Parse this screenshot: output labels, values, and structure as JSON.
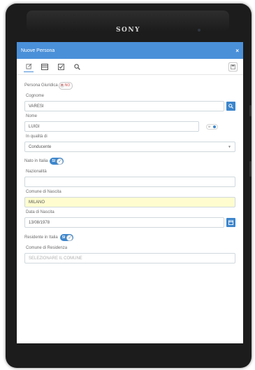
{
  "device": {
    "brand": "SONY"
  },
  "window": {
    "title": "Nuove Persona",
    "close_glyph": "×"
  },
  "toolbar": {
    "icons": [
      "edit-icon",
      "card-icon",
      "checkbox-icon",
      "search-icon"
    ],
    "right_icon": "save-icon"
  },
  "form": {
    "persona_giuridica": {
      "label": "Persona Giuridica",
      "toggle_text": "NO"
    },
    "cognome": {
      "label": "Cognome",
      "value": "VARESI"
    },
    "nome": {
      "label": "Nome",
      "value": "LUIGI",
      "toggle_left": "M",
      "toggle_right": "F"
    },
    "in_qualita": {
      "label": "In qualità di",
      "value": "Conducente"
    },
    "nato_in_italia": {
      "label": "Nato in Italia",
      "toggle_text": "SI"
    },
    "nazionalita": {
      "label": "Nazionalità",
      "value": ""
    },
    "comune_nascita": {
      "label": "Comune di Nascita",
      "value": "MILANO"
    },
    "data_nascita": {
      "label": "Data di Nascita",
      "value": "13/08/1978"
    },
    "residente_in_italia": {
      "label": "Residente in Italia",
      "toggle_text": "SI"
    },
    "comune_residenza": {
      "label": "Comune di Residenza",
      "placeholder": "SELEZIONARE IL COMUNE"
    }
  },
  "colors": {
    "primary": "#4a90d9",
    "button": "#3d86cc",
    "highlight": "#fffdd0",
    "danger": "#d9534f"
  }
}
